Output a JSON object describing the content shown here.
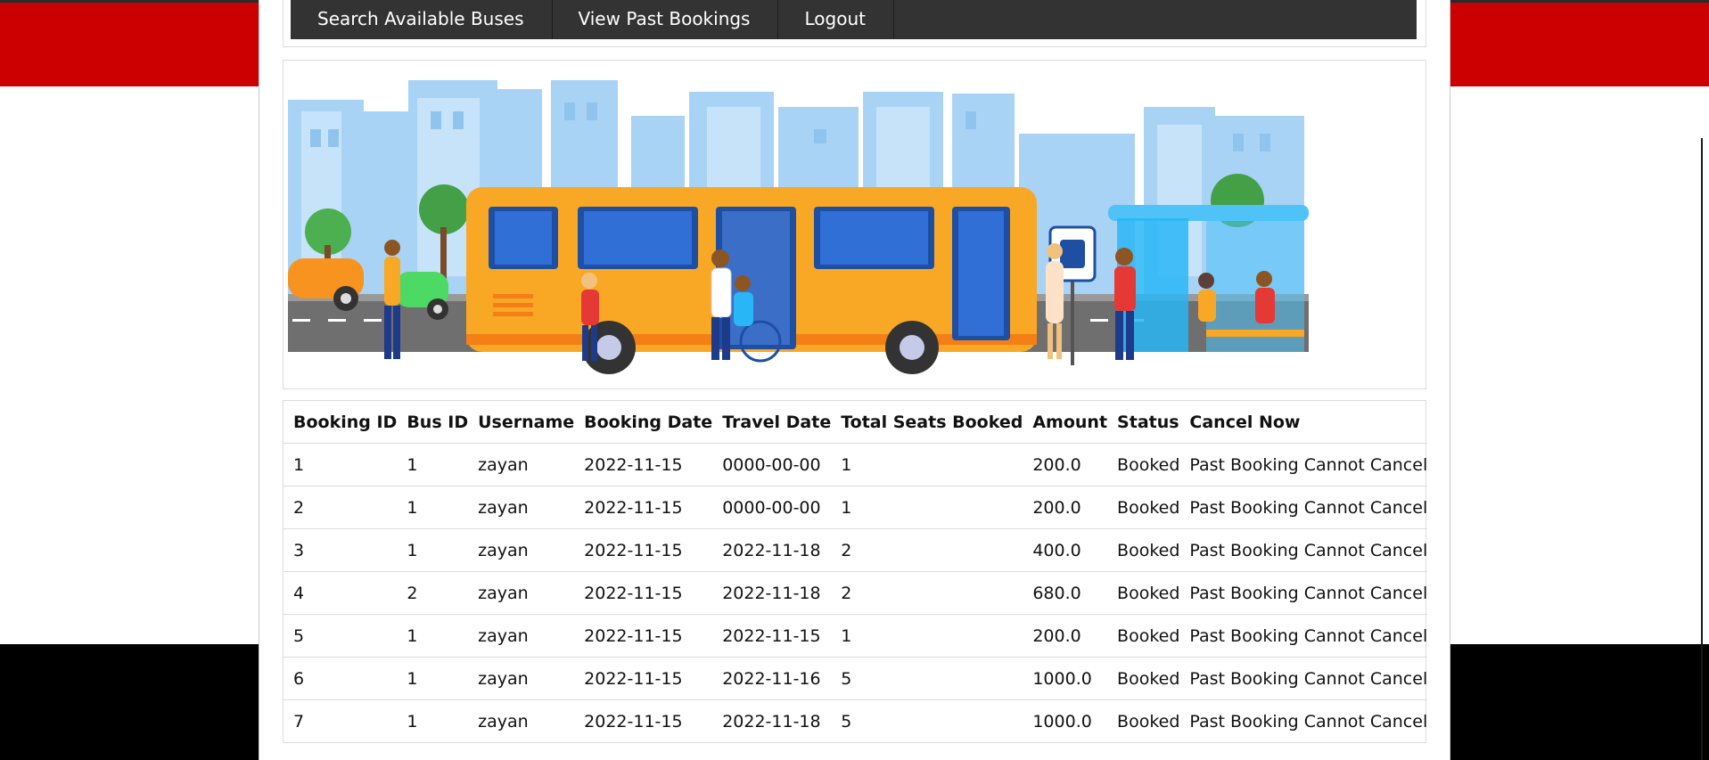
{
  "nav": {
    "items": [
      {
        "label": "Search Available Buses"
      },
      {
        "label": "View Past Bookings"
      },
      {
        "label": "Logout"
      }
    ]
  },
  "colors": {
    "accent_red": "#cc0000",
    "navbar_bg": "#333333",
    "footer_black": "#000000"
  },
  "banner": {
    "icon": "bus-stop-illustration"
  },
  "table": {
    "headers": [
      "Booking ID",
      "Bus ID",
      "Username",
      "Booking Date",
      "Travel Date",
      "Total Seats Booked",
      "Amount",
      "Status",
      "Cancel Now"
    ],
    "rows": [
      [
        "1",
        "1",
        "zayan",
        "2022-11-15",
        "0000-00-00",
        "1",
        "200.0",
        "Booked",
        "Past Booking Cannot Cancel"
      ],
      [
        "2",
        "1",
        "zayan",
        "2022-11-15",
        "0000-00-00",
        "1",
        "200.0",
        "Booked",
        "Past Booking Cannot Cancel"
      ],
      [
        "3",
        "1",
        "zayan",
        "2022-11-15",
        "2022-11-18",
        "2",
        "400.0",
        "Booked",
        "Past Booking Cannot Cancel"
      ],
      [
        "4",
        "2",
        "zayan",
        "2022-11-15",
        "2022-11-18",
        "2",
        "680.0",
        "Booked",
        "Past Booking Cannot Cancel"
      ],
      [
        "5",
        "1",
        "zayan",
        "2022-11-15",
        "2022-11-15",
        "1",
        "200.0",
        "Booked",
        "Past Booking Cannot Cancel"
      ],
      [
        "6",
        "1",
        "zayan",
        "2022-11-15",
        "2022-11-16",
        "5",
        "1000.0",
        "Booked",
        "Past Booking Cannot Cancel"
      ],
      [
        "7",
        "1",
        "zayan",
        "2022-11-15",
        "2022-11-18",
        "5",
        "1000.0",
        "Booked",
        "Past Booking Cannot Cancel"
      ]
    ]
  }
}
